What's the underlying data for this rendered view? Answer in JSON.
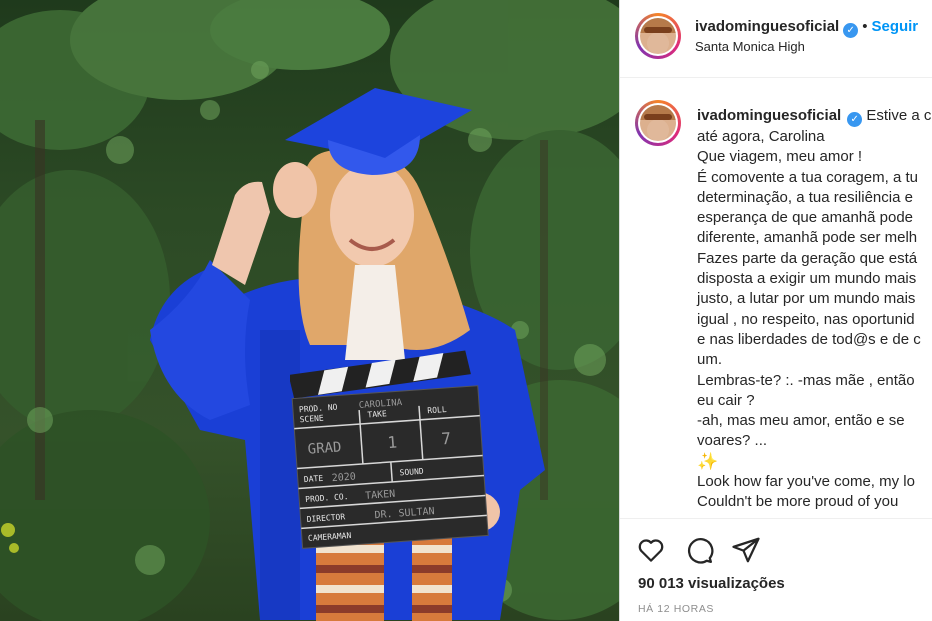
{
  "post": {
    "username": "ivadominguesoficial",
    "verified_icon": "verified-badge-icon",
    "separator": "•",
    "follow_label": "Seguir",
    "location": "Santa Monica High"
  },
  "caption": {
    "username": "ivadominguesoficial",
    "first_line": "Estive a c",
    "lines": [
      "até agora, Carolina",
      "Que viagem, meu amor !",
      "É comovente a tua coragem, a tu",
      "determinação, a tua resiliência e",
      "esperança de que amanhã pode",
      "diferente, amanhã pode ser melh",
      "Fazes parte da geração que está",
      "disposta a exigir um mundo mais",
      "justo, a lutar por um mundo mais",
      "igual , no respeito, nas oportunid",
      "e nas liberdades de tod@s e de c",
      "um.",
      "Lembras-te? :. -mas mãe , então",
      "eu cair ?",
      "-ah, mas meu amor, então e se",
      "voares? ...",
      "✨",
      "Look how far you've come, my lo",
      "Couldn't be more proud of you"
    ]
  },
  "footer": {
    "views": "90 013 visualizações",
    "time": "HÁ 12 HORAS"
  },
  "media": {
    "clapperboard": {
      "prod_no_label": "PROD. NO",
      "prod_no_value": "CAROLINA",
      "scene_label": "SCENE",
      "scene_value": "GRAD",
      "take_label": "TAKE",
      "take_value": "1",
      "roll_label": "ROLL",
      "roll_value": "7",
      "date_label": "DATE",
      "date_value": "2020",
      "sound_label": "SOUND",
      "prod_co_label": "PROD. CO.",
      "prod_co_value": "TAKEN",
      "director_label": "DIRECTOR",
      "director_value": "DR. SULTAN",
      "camera_label": "CAMERAMAN"
    }
  },
  "colors": {
    "accent_blue": "#0095f6",
    "gown_blue": "#1a3fd6",
    "text": "#262626",
    "muted": "#8e8e8e"
  }
}
